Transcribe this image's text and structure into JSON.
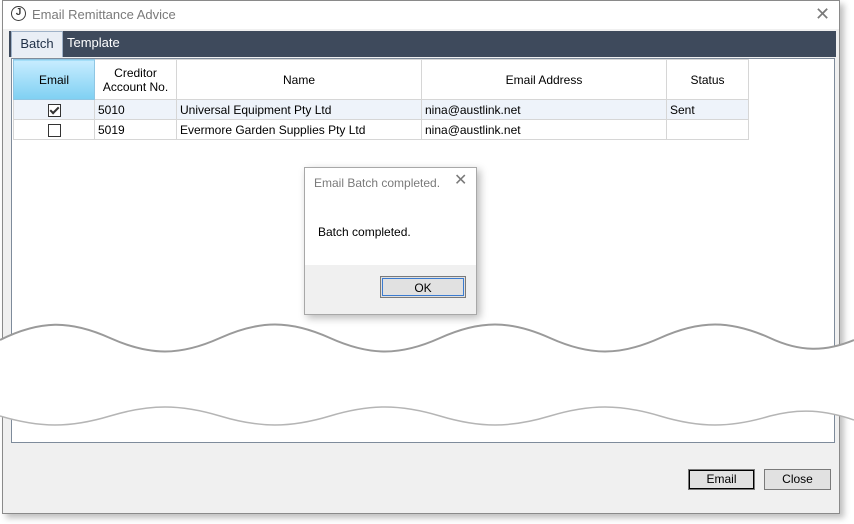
{
  "window": {
    "title": "Email Remittance Advice"
  },
  "tabs": [
    {
      "label": "Batch"
    },
    {
      "label": "Template"
    }
  ],
  "grid": {
    "headers": [
      "Email",
      "Creditor Account No.",
      "Name",
      "Email Address",
      "Status"
    ],
    "rows": [
      {
        "email_checked": true,
        "account": "5010",
        "name": "Universal Equipment Pty Ltd",
        "email": "nina@austlink.net",
        "status": "Sent"
      },
      {
        "email_checked": false,
        "account": "5019",
        "name": "Evermore Garden Supplies Pty Ltd",
        "email": "nina@austlink.net",
        "status": ""
      }
    ]
  },
  "dialog": {
    "title": "Email Batch completed.",
    "message": "Batch completed.",
    "ok_label": "OK"
  },
  "footer": {
    "email_label": "Email",
    "close_label": "Close"
  },
  "colors": {
    "tab_bar": "#3e4a5c",
    "header_selected": "#7fd0f2",
    "row_alt": "#eef3fa"
  },
  "icons": {
    "app": "app-logo-icon",
    "close": "close-icon"
  }
}
